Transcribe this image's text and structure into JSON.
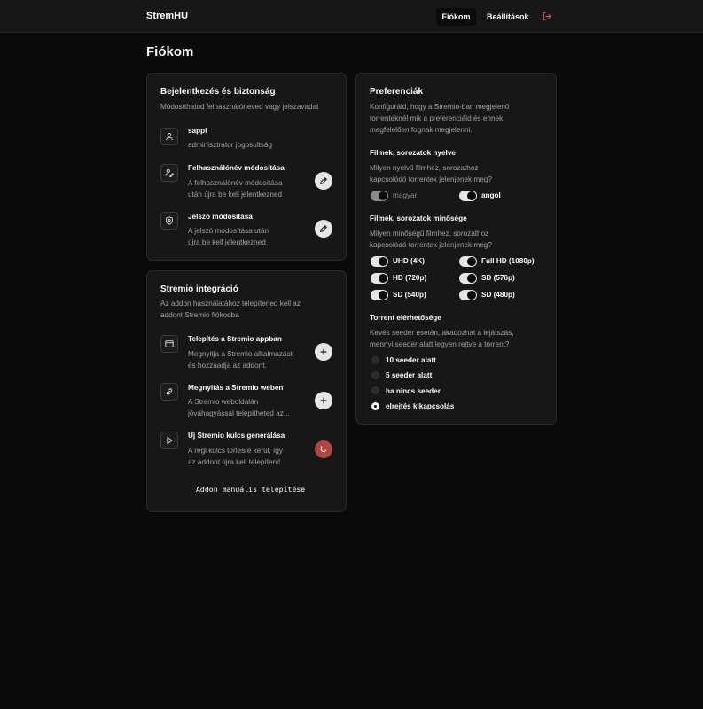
{
  "app": {
    "brand": "StremHU"
  },
  "nav": {
    "account": "Fiókom",
    "settings": "Beállítások"
  },
  "page": {
    "title": "Fiókom"
  },
  "security": {
    "title": "Bejelentkezés és biztonság",
    "subtitle": "Módosíthatod felhasználóneved vagy jelszavadat",
    "user": {
      "name": "sappi",
      "role": "adminisztrátor jogosultság"
    },
    "username_change": {
      "title": "Felhasználónév módosítása",
      "desc1": "A felhasználónév módosítása",
      "desc2": "után újra be kell jelentkezned"
    },
    "password_change": {
      "title": "Jelszó módosítása",
      "desc1": "A jelszó módosítása után",
      "desc2": "újra be kell jelentkezned"
    }
  },
  "stremio": {
    "title": "Stremio integráció",
    "subtitle1": "Az addon használatához telepítened kell az",
    "subtitle2": "addont Stremio fiókodba",
    "install_app": {
      "title": "Telepítés a Stremio appban",
      "desc1": "Megnyitja a Stremio alkalmazást",
      "desc2": "és hozzáadja az addont."
    },
    "open_web": {
      "title": "Megnyitás a Stremio weben",
      "desc1": "A Stremio weboldalán",
      "desc2": "jóváhagyással telepítheted az..."
    },
    "new_key": {
      "title": "Új Stremio kulcs generálása",
      "desc1": "A régi kulcs törlésre kerül, így",
      "desc2": "az addont újra kell telepíteni!"
    },
    "manual_install": "Addon manuális telepítése"
  },
  "preferences": {
    "title": "Preferenciák",
    "desc1": "Konfiguráld, hogy a Stremio-ban megjelenő",
    "desc2": "torrenteknél mik a preferenciáid és ennek",
    "desc3": "megfelelően fognak megjelenni.",
    "language": {
      "title": "Filmek, sorozatok nyelve",
      "desc1": "Milyen nyelvű filmhez, sorozathoz",
      "desc2": "kapcsolódó torrentek jelenjenek meg?",
      "options": [
        {
          "label": "magyar",
          "on": true,
          "disabled": true
        },
        {
          "label": "angol",
          "on": true,
          "disabled": false
        }
      ]
    },
    "quality": {
      "title": "Filmek, sorozatok minősége",
      "desc1": "Milyen minőségű filmhez, sorozathoz",
      "desc2": "kapcsolódó torrentek jelenjenek meg?",
      "options": [
        {
          "label": "UHD (4K)",
          "on": true
        },
        {
          "label": "Full HD (1080p)",
          "on": true
        },
        {
          "label": "HD (720p)",
          "on": true
        },
        {
          "label": "SD (576p)",
          "on": true
        },
        {
          "label": "SD (540p)",
          "on": true
        },
        {
          "label": "SD (480p)",
          "on": true
        }
      ]
    },
    "availability": {
      "title": "Torrent elérhetősége",
      "desc1": "Kevés seeder esetén, akadozhat a lejátszás,",
      "desc2": "mennyi seeder alatt legyen rejtve a torrent?",
      "options": [
        {
          "label": "10 seeder alatt",
          "checked": false
        },
        {
          "label": "5 seeder alatt",
          "checked": false
        },
        {
          "label": "ha nincs seeder",
          "checked": false
        },
        {
          "label": "elrejtés kikapcsolás",
          "checked": true
        }
      ]
    }
  },
  "colors": {
    "background": "#0a0a0a",
    "card": "#171717",
    "accent_danger": "#b04545",
    "logout_icon": "#e05555"
  },
  "icons": {
    "logout": "logout-icon",
    "user": "user-icon",
    "user_edit": "user-edit-icon",
    "shield": "shield-icon",
    "pencil": "pencil-icon",
    "browser": "browser-window-icon",
    "link": "link-icon",
    "play": "play-icon",
    "plus": "plus-icon",
    "refresh": "refresh-icon"
  }
}
